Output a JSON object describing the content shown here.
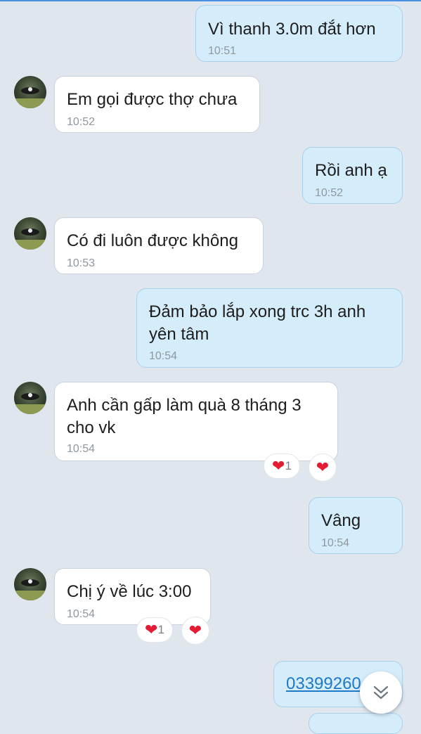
{
  "messages": [
    {
      "text": "Vì thanh 3.0m đắt hơn",
      "time": "10:51"
    },
    {
      "text": "Em gọi được thợ chưa",
      "time": "10:52"
    },
    {
      "text": "Rồi anh ạ",
      "time": "10:52"
    },
    {
      "text": "Có đi luôn được không",
      "time": "10:53"
    },
    {
      "text_line1": "Đảm bảo lắp xong trc 3h anh",
      "text_line2": "yên tâm",
      "time": "10:54"
    },
    {
      "text_line1": "Anh cần gấp làm quà 8 tháng 3",
      "text_line2": "cho vk",
      "time": "10:54",
      "reaction_count": "1"
    },
    {
      "text": "Vâng",
      "time": "10:54"
    },
    {
      "text": "Chị ý về lúc 3:00",
      "time": "10:54",
      "reaction_count": "1"
    },
    {
      "text": "03399260"
    }
  ],
  "icons": {
    "heart": "heart-icon",
    "scroll_down": "double-chevron-down-icon",
    "avatar": "contact-avatar"
  },
  "colors": {
    "incoming_bubble": "#ffffff",
    "outgoing_bubble": "#d5edfa",
    "background": "#e0e6ee",
    "heart": "#e31c33",
    "link": "#1e7ac8"
  }
}
